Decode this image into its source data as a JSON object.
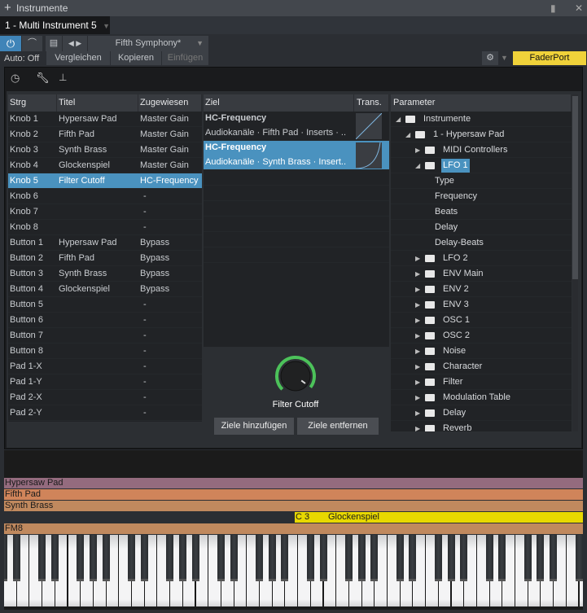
{
  "window": {
    "title": "Instrumente",
    "tab": "1 - Multi Instrument 5"
  },
  "toolbar": {
    "preset": "Fifth Symphony*",
    "auto": "Auto: Off",
    "compare": "Vergleichen",
    "copy": "Kopieren",
    "paste": "Einfügen",
    "device": "FaderPort",
    "device_color": "#f0d23a"
  },
  "controls_table": {
    "headers": [
      "Strg",
      "Titel",
      "Zugewiesen"
    ],
    "rows": [
      [
        "Knob 1",
        "Hypersaw Pad",
        "Master Gain"
      ],
      [
        "Knob 2",
        "Fifth Pad",
        "Master Gain"
      ],
      [
        "Knob 3",
        "Synth Brass",
        "Master Gain"
      ],
      [
        "Knob 4",
        "Glockenspiel",
        "Master Gain"
      ],
      [
        "Knob 5",
        "Filter Cutoff",
        "HC-Frequency"
      ],
      [
        "Knob 6",
        "",
        "-"
      ],
      [
        "Knob 7",
        "",
        "-"
      ],
      [
        "Knob 8",
        "",
        "-"
      ],
      [
        "Button 1",
        "Hypersaw Pad",
        "Bypass"
      ],
      [
        "Button 2",
        "Fifth Pad",
        "Bypass"
      ],
      [
        "Button 3",
        "Synth Brass",
        "Bypass"
      ],
      [
        "Button 4",
        "Glockenspiel",
        "Bypass"
      ],
      [
        "Button 5",
        "",
        "-"
      ],
      [
        "Button 6",
        "",
        "-"
      ],
      [
        "Button 7",
        "",
        "-"
      ],
      [
        "Button 8",
        "",
        "-"
      ],
      [
        "Pad 1-X",
        "",
        "-"
      ],
      [
        "Pad 1-Y",
        "",
        "-"
      ],
      [
        "Pad 2-X",
        "",
        "-"
      ],
      [
        "Pad 2-Y",
        "",
        "-"
      ]
    ],
    "selected": 4
  },
  "targets": {
    "headers": [
      "Ziel",
      "Trans."
    ],
    "rows": [
      {
        "title": "HC-Frequency",
        "path": "Audiokanäle · Fifth Pad · Inserts · ..",
        "curve": "linear"
      },
      {
        "title": "HC-Frequency",
        "path": "Audiokanäle · Synth Brass · Insert..",
        "curve": "exponential"
      }
    ],
    "selected": 1,
    "knob_label": "Filter Cutoff",
    "knob_value": 0.97,
    "add": "Ziele hinzufügen",
    "remove": "Ziele entfernen"
  },
  "parameters": {
    "header": "Parameter",
    "items": [
      {
        "label": "Instrumente",
        "level": 0,
        "folder": true,
        "state": "open"
      },
      {
        "label": "1 - Hypersaw Pad",
        "level": 1,
        "folder": true,
        "state": "open"
      },
      {
        "label": "MIDI Controllers",
        "level": 2,
        "folder": true,
        "state": "closed"
      },
      {
        "label": "LFO 1",
        "level": 2,
        "folder": true,
        "state": "open",
        "selected": true
      },
      {
        "label": "Type",
        "level": 3
      },
      {
        "label": "Frequency",
        "level": 3
      },
      {
        "label": "Beats",
        "level": 3
      },
      {
        "label": "Delay",
        "level": 3
      },
      {
        "label": "Delay-Beats",
        "level": 3
      },
      {
        "label": "LFO 2",
        "level": 2,
        "folder": true,
        "state": "closed"
      },
      {
        "label": "ENV Main",
        "level": 2,
        "folder": true,
        "state": "closed"
      },
      {
        "label": "ENV 2",
        "level": 2,
        "folder": true,
        "state": "closed"
      },
      {
        "label": "ENV 3",
        "level": 2,
        "folder": true,
        "state": "closed"
      },
      {
        "label": "OSC 1",
        "level": 2,
        "folder": true,
        "state": "closed"
      },
      {
        "label": "OSC 2",
        "level": 2,
        "folder": true,
        "state": "closed"
      },
      {
        "label": "Noise",
        "level": 2,
        "folder": true,
        "state": "closed"
      },
      {
        "label": "Character",
        "level": 2,
        "folder": true,
        "state": "closed"
      },
      {
        "label": "Filter",
        "level": 2,
        "folder": true,
        "state": "closed"
      },
      {
        "label": "Modulation Table",
        "level": 2,
        "folder": true,
        "state": "closed"
      },
      {
        "label": "Delay",
        "level": 2,
        "folder": true,
        "state": "closed"
      },
      {
        "label": "Reverb",
        "level": 2,
        "folder": true,
        "state": "closed"
      }
    ]
  },
  "zones": [
    {
      "label": "Hypersaw Pad",
      "color": "#946b7e"
    },
    {
      "label": "Fifth Pad",
      "color": "#d0845a"
    },
    {
      "label": "Synth Brass",
      "color": "#c0895e"
    },
    {
      "label": "Glockenspiel",
      "note": "C 3",
      "color": "#e8d800"
    },
    {
      "label": "FM8",
      "color": "#c0895e"
    }
  ]
}
